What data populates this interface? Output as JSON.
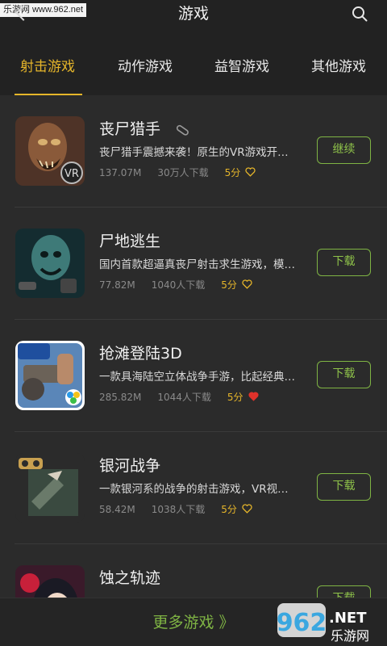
{
  "watermark_top": "乐游网 www.962.net",
  "header": {
    "title": "游戏"
  },
  "tabs": [
    "射击游戏",
    "动作游戏",
    "益智游戏",
    "其他游戏"
  ],
  "games": [
    {
      "name": "丧尸猎手",
      "desc": "丧尸猎手震撼来袭！原生的VR游戏开…",
      "size": "137.07M",
      "downloads": "30万人下载",
      "rating": "5分",
      "liked": false,
      "button": "继续"
    },
    {
      "name": "尸地逃生",
      "desc": "国内首款超逼真丧尸射击求生游戏，模…",
      "size": "77.82M",
      "downloads": "1040人下载",
      "rating": "5分",
      "liked": false,
      "button": "下载"
    },
    {
      "name": "抢滩登陆3D",
      "desc": "一款具海陆空立体战争手游，比起经典…",
      "size": "285.82M",
      "downloads": "1044人下载",
      "rating": "5分",
      "liked": true,
      "button": "下载"
    },
    {
      "name": "银河战争",
      "desc": "一款银河系的战争的射击游戏，VR视…",
      "size": "58.42M",
      "downloads": "1038人下载",
      "rating": "5分",
      "liked": false,
      "button": "下载"
    },
    {
      "name": "蚀之轨迹",
      "desc": "",
      "size": "",
      "downloads": "",
      "rating": "",
      "liked": false,
      "button": "下载"
    }
  ],
  "footer": {
    "more": "更多游戏 》"
  },
  "watermark_br": {
    "big": "962",
    "suffix": ".NET",
    "sub": "乐游网"
  },
  "colors": {
    "accent_yellow": "#e5b52a",
    "accent_green": "#7fb444",
    "liked_red": "#e0322b"
  }
}
